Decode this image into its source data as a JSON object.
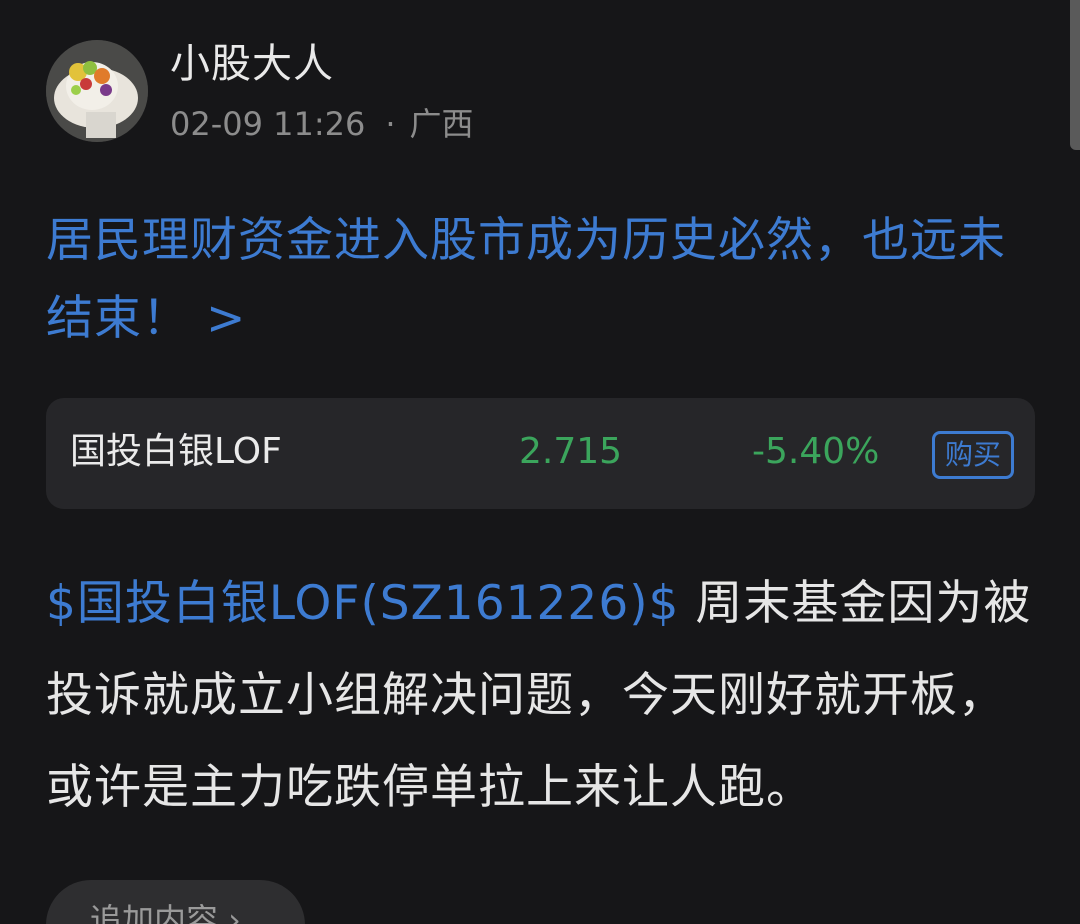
{
  "post": {
    "author": "小股大人",
    "time": "02-09 11:26",
    "separator": "·",
    "location": "广西",
    "headline": "居民理财资金进入股市成为历史必然，也远未结束！ >",
    "body_tag": "$国投白银LOF(SZ161226)$",
    "body_text": " 周末基金因为被投诉就成立小组解决问题，今天刚好就开板，或许是主力吃跌停单拉上来让人跑。"
  },
  "fund": {
    "name": "国投白银LOF",
    "price": "2.715",
    "change": "-5.40%",
    "buy_label": "购买",
    "color": "#3ba55c"
  },
  "actions": {
    "add_content": "追加内容 ›"
  },
  "colors": {
    "accent": "#3d7bd1",
    "down": "#3ba55c",
    "background": "#161618"
  }
}
